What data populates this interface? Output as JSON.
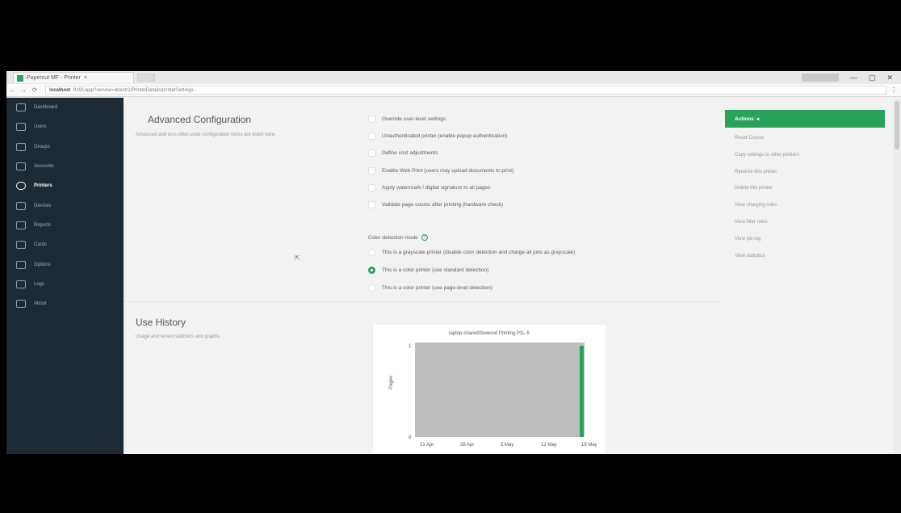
{
  "browser": {
    "tab_title": "Papercut MF - Printer",
    "new_tab": "+",
    "window_controls": [
      "—",
      "▢",
      "✕"
    ],
    "url_host": "localhost",
    "url_path": ":9191/app?service=direct/1/PrinterDetails/printerSettings.."
  },
  "sidebar": {
    "items": [
      {
        "label": "Dashboard",
        "icon": "dashboard-icon",
        "active": false
      },
      {
        "label": "Users",
        "icon": "users-icon",
        "active": false
      },
      {
        "label": "Groups",
        "icon": "groups-icon",
        "active": false
      },
      {
        "label": "Accounts",
        "icon": "accounts-icon",
        "active": false
      },
      {
        "label": "Printers",
        "icon": "printer-icon",
        "active": true
      },
      {
        "label": "Devices",
        "icon": "devices-icon",
        "active": false
      },
      {
        "label": "Reports",
        "icon": "reports-icon",
        "active": false
      },
      {
        "label": "Cards",
        "icon": "cards-icon",
        "active": false
      },
      {
        "label": "Options",
        "icon": "options-icon",
        "active": false
      },
      {
        "label": "Logs",
        "icon": "logs-icon",
        "active": false
      },
      {
        "label": "About",
        "icon": "about-icon",
        "active": false
      }
    ]
  },
  "advanced": {
    "title": "Advanced Configuration",
    "description": "Advanced and less often used configuration items are listed here.",
    "options": [
      "Override user-level settings",
      "Unauthenticated printer (enable popup authentication)",
      "Define cost adjustments",
      "Enable Web Print (users may upload documents to print)",
      "Apply watermark / digital signature to all pages",
      "Validate page counts after printing (hardware check)"
    ],
    "color_mode_label": "Color detection mode",
    "help_glyph": "?",
    "color_modes": [
      {
        "label": "This is a grayscale printer (disable color detection and charge all jobs as grayscale)",
        "selected": false
      },
      {
        "label": "This is a color printer (use standard detection)",
        "selected": true
      },
      {
        "label": "This is a color printer (use page-level detection)",
        "selected": false
      }
    ]
  },
  "history": {
    "title": "Use History",
    "description": "Usage and recent statistics and graphs."
  },
  "chart_data": {
    "type": "bar",
    "title": "laptop-shared\\Sewood Printing P1L-5",
    "ylabel": "Pages",
    "xlabel": "",
    "x_ticks": [
      "21 Apr",
      "28 Apr",
      "5 May",
      "12 May",
      "19 May"
    ],
    "y_ticks": [
      "0",
      "1"
    ],
    "ylim": [
      0,
      1
    ],
    "bar_count": 30,
    "values": [
      0,
      0,
      0,
      0,
      0,
      0,
      0,
      0,
      0,
      0,
      0,
      0,
      0,
      0,
      0,
      0,
      0,
      0,
      0,
      0,
      0,
      0,
      0,
      0,
      0,
      0,
      0,
      0,
      0,
      1
    ],
    "plot_bg": "#bdbdbd",
    "bar_color": "#27a35a"
  },
  "actions": {
    "header": "Actions",
    "items": [
      "Reset Counts",
      "Copy settings to other printers",
      "Rename this printer",
      "Delete this printer",
      "View charging rules",
      "View filter rules",
      "View job log",
      "View statistics"
    ]
  },
  "colors": {
    "accent": "#27a35a",
    "sidebar_bg": "#1d2b36"
  }
}
